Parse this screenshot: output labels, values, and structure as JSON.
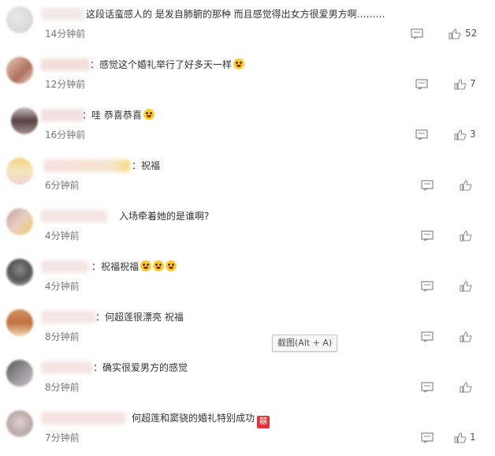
{
  "comments": [
    {
      "text": "这段话蛮感人的 是发自肺腑的那种 而且感觉得出女方很爱男方啊………",
      "time": "14分钟前",
      "likes": "52",
      "emoji": ""
    },
    {
      "text": "：感觉这个婚礼举行了好多天一样",
      "time": "12分钟前",
      "likes": "7",
      "emoji": "laugh"
    },
    {
      "text": "：哇 恭喜恭喜",
      "time": "16分钟前",
      "likes": "3",
      "emoji": "cry"
    },
    {
      "text": "：祝福",
      "time": "6分钟前",
      "likes": "",
      "emoji": ""
    },
    {
      "text": "入场牵着她的是谁啊?",
      "time": "4分钟前",
      "likes": "",
      "emoji": ""
    },
    {
      "text": "：祝福祝福",
      "time": "4分钟前",
      "likes": "",
      "emoji": "cry3"
    },
    {
      "text": "：何超莲很漂亮 祝福",
      "time": "8分钟前",
      "likes": "",
      "emoji": ""
    },
    {
      "text": "：确实很爱男方的感觉",
      "time": "8分钟前",
      "likes": "",
      "emoji": ""
    },
    {
      "text": "何超莲和窦骁的婚礼特别成功",
      "time": "7分钟前",
      "likes": "1",
      "emoji": "囍"
    }
  ],
  "tooltip": "截图(Alt + A)",
  "icons": {
    "reply": "comment-icon",
    "like": "thumbs-up-icon"
  },
  "colors": {
    "text": "#333333",
    "time": "#777777",
    "icon": "#888888"
  }
}
